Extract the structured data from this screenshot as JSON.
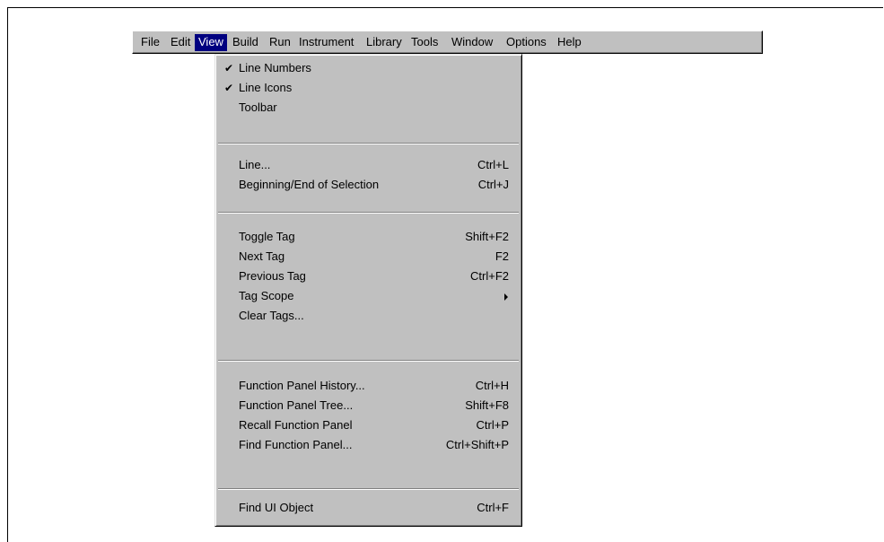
{
  "menubar": {
    "items": [
      {
        "label": "File"
      },
      {
        "label": "Edit"
      },
      {
        "label": "View"
      },
      {
        "label": "Build"
      },
      {
        "label": "Run"
      },
      {
        "label": "Instrument"
      },
      {
        "label": "Library"
      },
      {
        "label": "Tools"
      },
      {
        "label": "Window"
      },
      {
        "label": "Options"
      },
      {
        "label": "Help"
      }
    ],
    "active": "View"
  },
  "view_menu": {
    "groups": [
      [
        {
          "label": "Line Numbers",
          "checked": true
        },
        {
          "label": "Line Icons",
          "checked": true
        },
        {
          "label": "Toolbar",
          "checked": false
        }
      ],
      [
        {
          "label": "Line...",
          "shortcut": "Ctrl+L"
        },
        {
          "label": "Beginning/End of Selection",
          "shortcut": "Ctrl+J"
        }
      ],
      [
        {
          "label": "Toggle Tag",
          "shortcut": "Shift+F2"
        },
        {
          "label": "Next Tag",
          "shortcut": "F2"
        },
        {
          "label": "Previous Tag",
          "shortcut": "Ctrl+F2"
        },
        {
          "label": "Tag Scope",
          "submenu": true
        },
        {
          "label": "Clear Tags..."
        }
      ],
      [
        {
          "label": "Function Panel History...",
          "shortcut": "Ctrl+H"
        },
        {
          "label": "Function Panel Tree...",
          "shortcut": "Shift+F8"
        },
        {
          "label": "Recall Function Panel",
          "shortcut": "Ctrl+P"
        },
        {
          "label": "Find Function Panel...",
          "shortcut": "Ctrl+Shift+P"
        }
      ],
      [
        {
          "label": "Find UI Object",
          "shortcut": "Ctrl+F"
        }
      ]
    ]
  },
  "colors": {
    "menu_face": "#c0c0c0",
    "highlight": "#000080",
    "highlight_text": "#ffffff"
  }
}
